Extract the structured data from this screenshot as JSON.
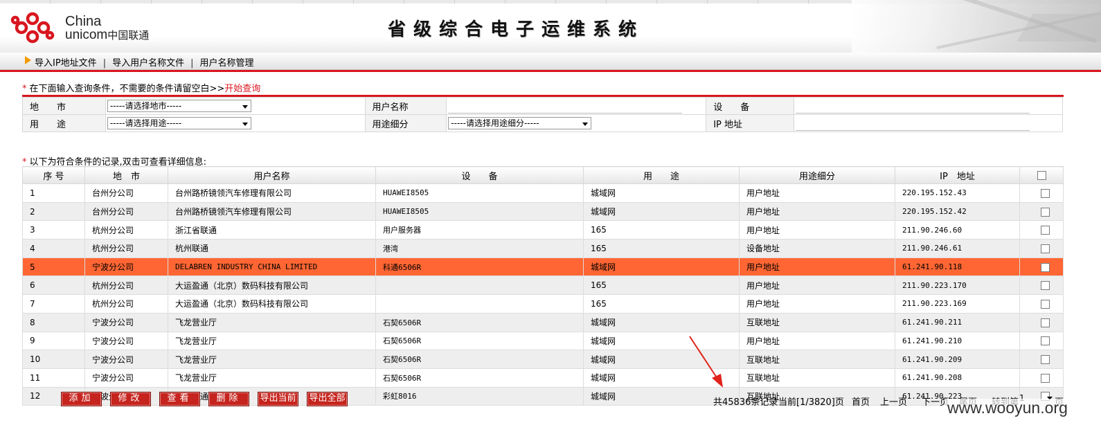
{
  "header": {
    "logo_line1": "China",
    "logo_line2": "unicom",
    "logo_cn": "中国联通",
    "system_title": "省级综合电子运维系统"
  },
  "nav": {
    "items": [
      "导入IP地址文件",
      "导入用户名称文件",
      "用户名称管理"
    ],
    "separator": "|"
  },
  "query": {
    "note_star": "*",
    "note_text": "在下面输入查询条件，不需要的条件请留空白>>",
    "start_link": "开始查询",
    "city_label": "地　　市",
    "city_select": "-----请选择地市-----",
    "username_label": "用户名称",
    "username_value": "",
    "device_label": "设　　备",
    "device_value": "",
    "usage_label": "用　　途",
    "usage_select": "-----请选择用途-----",
    "usage_detail_label": "用途细分",
    "usage_detail_select": "-----请选择用途细分-----",
    "ip_label": "IP 地址",
    "ip_value": ""
  },
  "results": {
    "note_star": "*",
    "note_text": "以下为符合条件的记录,双击可查看详细信息:",
    "columns": [
      "序 号",
      "地　市",
      "用户名称",
      "设　　备",
      "用　　途",
      "用途细分",
      "IP　地址"
    ],
    "rows": [
      {
        "no": "1",
        "city": "台州分公司",
        "user": "台州路桥镜领汽车修理有限公司",
        "device": "HUAWEI8505",
        "usage": "城域网",
        "detail": "用户地址",
        "ip": "220.195.152.43"
      },
      {
        "no": "2",
        "city": "台州分公司",
        "user": "台州路桥镜领汽车修理有限公司",
        "device": "HUAWEI8505",
        "usage": "城域网",
        "detail": "用户地址",
        "ip": "220.195.152.42"
      },
      {
        "no": "3",
        "city": "杭州分公司",
        "user": "浙江省联通",
        "device": "用户服务器",
        "usage": "165",
        "detail": "用户地址",
        "ip": "211.90.246.60"
      },
      {
        "no": "4",
        "city": "杭州分公司",
        "user": "杭州联通",
        "device": "港湾",
        "usage": "165",
        "detail": "设备地址",
        "ip": "211.90.246.61"
      },
      {
        "no": "5",
        "city": "宁波分公司",
        "user": "DELABREN INDUSTRY CHINA LIMITED",
        "device": "科通6506R",
        "usage": "城域网",
        "detail": "用户地址",
        "ip": "61.241.90.118"
      },
      {
        "no": "6",
        "city": "杭州分公司",
        "user": "大运盈通（北京）数码科技有限公司",
        "device": "",
        "usage": "165",
        "detail": "用户地址",
        "ip": "211.90.223.170"
      },
      {
        "no": "7",
        "city": "杭州分公司",
        "user": "大运盈通（北京）数码科技有限公司",
        "device": "",
        "usage": "165",
        "detail": "用户地址",
        "ip": "211.90.223.169"
      },
      {
        "no": "8",
        "city": "宁波分公司",
        "user": "飞龙营业厅",
        "device": "石契6506R",
        "usage": "城域网",
        "detail": "互联地址",
        "ip": "61.241.90.211"
      },
      {
        "no": "9",
        "city": "宁波分公司",
        "user": "飞龙营业厅",
        "device": "石契6506R",
        "usage": "城域网",
        "detail": "用户地址",
        "ip": "61.241.90.210"
      },
      {
        "no": "10",
        "city": "宁波分公司",
        "user": "飞龙营业厅",
        "device": "石契6506R",
        "usage": "城域网",
        "detail": "互联地址",
        "ip": "61.241.90.209"
      },
      {
        "no": "11",
        "city": "宁波分公司",
        "user": "飞龙营业厅",
        "device": "石契6506R",
        "usage": "城域网",
        "detail": "互联地址",
        "ip": "61.241.90.208"
      },
      {
        "no": "12",
        "city": "宁波分公司",
        "user": "宁波联通",
        "device": "彩虹8016",
        "usage": "城域网",
        "detail": "互联地址",
        "ip": "61.241.90.223"
      }
    ]
  },
  "actions": {
    "add": "添加",
    "edit": "修改",
    "view": "查看",
    "delete": "删除",
    "export_current": "导出当前",
    "export_all": "导出全部"
  },
  "pager": {
    "total": "共45836条记录",
    "current": "当前[1/3820]页",
    "first": "首页",
    "prev": "上一页",
    "next": "下一页",
    "last": "尾页",
    "jump_label": "转到第",
    "jump_value": "1",
    "jump_suffix": "页"
  },
  "watermark": "www.wooyun.org",
  "colors": {
    "accent_red": "#d8161f",
    "selected_row": "#ff6633",
    "nav_arrow": "#f39a00"
  }
}
